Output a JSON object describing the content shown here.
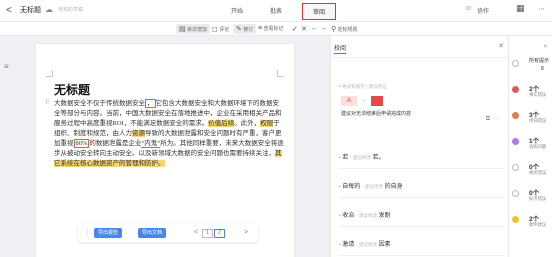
{
  "header": {
    "back": "<",
    "doc_title": "无标题",
    "save_status": "未知的草稿",
    "tabs": [
      "开始",
      "批表",
      "审阅"
    ],
    "collaborate": "协作"
  },
  "toolbar": {
    "items": [
      "目次增加",
      "评论",
      "修订",
      "查看标记",
      "修订",
      "定标规则"
    ]
  },
  "editor": {
    "heading": "无标题",
    "para_segments": [
      {
        "t": "大数据安全不仅于传统数据安全",
        "s": ""
      },
      {
        "t": "，",
        "s": "box"
      },
      {
        "t": "它包含大数据安全和大数据环境下的数据安全等部分与内容。当前，中国大数据安全在落地推进中，企业在采用相关产品和服务过程中高度重视ROI，不能满足数据安全的需求。",
        "s": ""
      },
      {
        "t": "价值后续",
        "s": "yellow"
      },
      {
        "t": "。此外，",
        "s": ""
      },
      {
        "t": "权限",
        "s": "yellow"
      },
      {
        "t": "于组织、制度和规范，由人力",
        "s": ""
      },
      {
        "t": "资源",
        "s": "yellow"
      },
      {
        "t": "导致的大数据泄露和安全问题时有严重，客户更加重视",
        "s": ""
      },
      {
        "t": "80%",
        "s": "box"
      },
      {
        "t": "的数据泄露是企业",
        "s": ""
      },
      {
        "t": "“内鬼”",
        "s": "underline"
      },
      {
        "t": "所为。其他同样重要，未来大数据安全将逐步从被动安全转向主动安全。以及新领域大数据的安全问题也需要持续关注，",
        "s": ""
      },
      {
        "t": "其它系统在核心数据资产的管理和防护。",
        "s": "yellow"
      }
    ],
    "buttons": [
      "导出报告",
      "导出文档"
    ],
    "pages": [
      "<",
      "1",
      "2",
      ">"
    ]
  },
  "panel": {
    "title": "校阅",
    "cards": [
      {
        "dot": "•",
        "label": "格式和规范",
        "meta": "建议修正",
        "from": "A",
        "to": "建议对无法结束后申请完成内容",
        "more": "⋯"
      },
      {
        "dot": "•",
        "label": "若",
        "meta": "建议修改",
        "to": "若。"
      },
      {
        "dot": "•",
        "label": "自每的",
        "meta": "建议修改",
        "to": "的自身"
      },
      {
        "dot": "•",
        "label": "收治",
        "meta": "建议修改",
        "to": "发耐"
      },
      {
        "dot": "•",
        "label": "激请",
        "meta": "建议修改",
        "to": "因素"
      }
    ]
  },
  "stats": [
    {
      "num": "所有提示",
      "label": "8",
      "sub": "",
      "color": "#ffffff",
      "ring": true
    },
    {
      "num": "2个",
      "label": "事实错误",
      "sub": "",
      "color": "#e05a5a"
    },
    {
      "num": "3个",
      "label": "用词错误",
      "sub": "",
      "color": "#e57b4a"
    },
    {
      "num": "1个",
      "label": "语病问题",
      "sub": "",
      "color": "#b07ce8"
    },
    {
      "num": "0个",
      "label": "格式错误",
      "sub": "",
      "color": "#ffffff",
      "ring": true
    },
    {
      "num": "0个",
      "label": "标点错误",
      "sub": "",
      "color": "#ffffff",
      "ring": true
    },
    {
      "num": "2个",
      "label": "稿件建议",
      "sub": "",
      "color": "#f1c232"
    }
  ]
}
